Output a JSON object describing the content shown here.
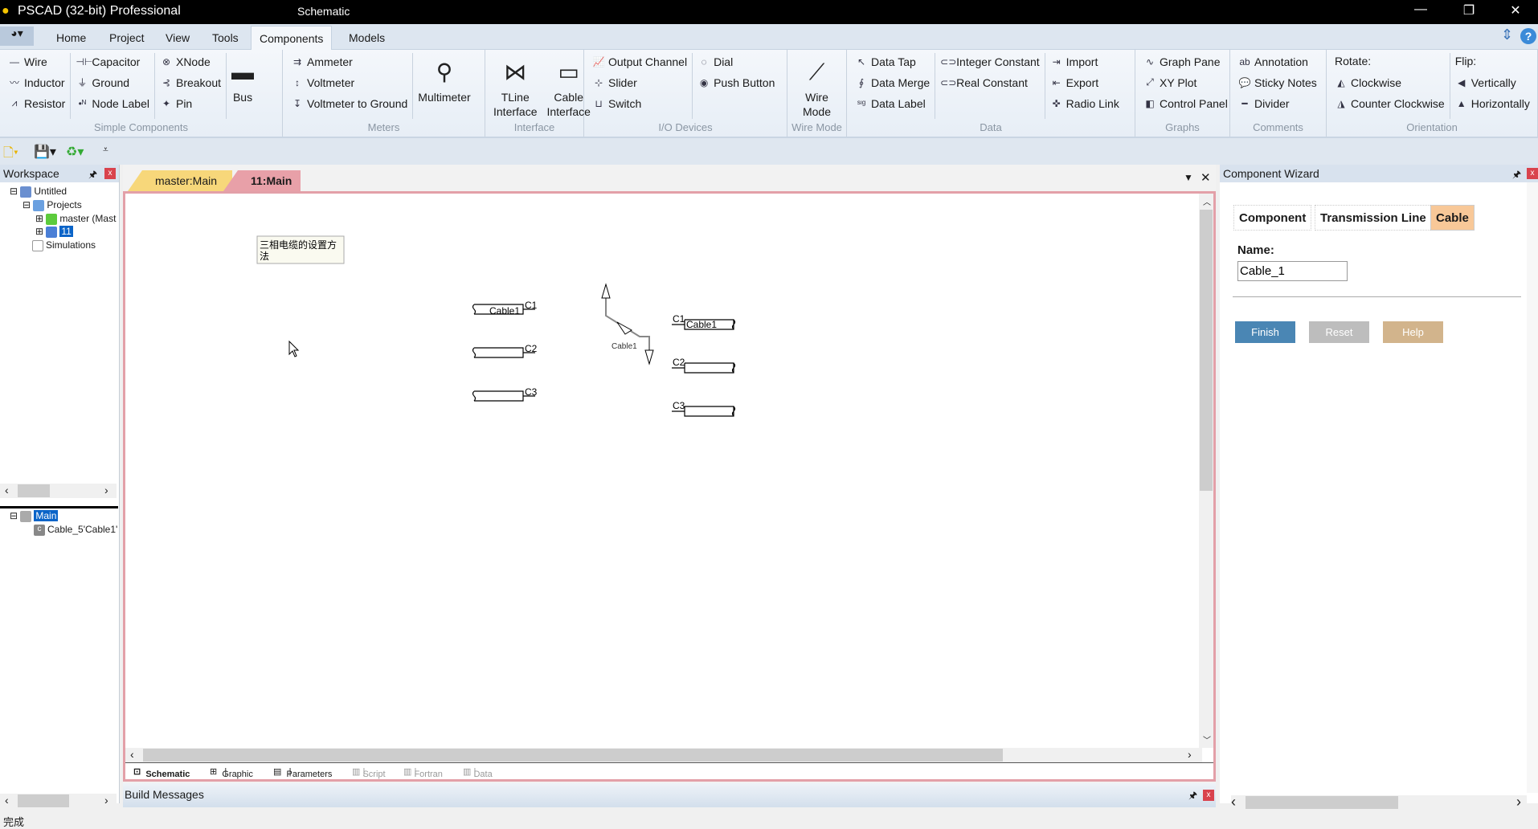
{
  "title": {
    "app": "PSCAD (32-bit) Professional",
    "context": "Schematic"
  },
  "ribbon_tabs": [
    "Home",
    "Project",
    "View",
    "Tools",
    "Components",
    "Models"
  ],
  "active_tab": "Components",
  "ribbon": [
    {
      "label": "Simple Components",
      "width": 352,
      "cols": [
        {
          "sep": true,
          "items": [
            {
              "icon": "—",
              "name": "wire",
              "text": "Wire"
            },
            {
              "icon": "〰",
              "name": "inductor",
              "text": "Inductor"
            },
            {
              "icon": "⩘",
              "name": "resistor",
              "text": "Resistor"
            }
          ]
        },
        {
          "sep": true,
          "items": [
            {
              "icon": "⊣⊢",
              "name": "capacitor",
              "text": "Capacitor"
            },
            {
              "icon": "⏚",
              "name": "ground",
              "text": "Ground"
            },
            {
              "icon": "•ᴺ",
              "name": "node-label",
              "text": "Node Label"
            }
          ]
        },
        {
          "sep": true,
          "items": [
            {
              "icon": "⊗",
              "name": "xnode",
              "text": "XNode"
            },
            {
              "icon": "⊰",
              "name": "breakout",
              "text": "Breakout"
            },
            {
              "icon": "✦",
              "name": "pin",
              "text": "Pin"
            }
          ]
        },
        {
          "big": {
            "icon": "▬",
            "name": "bus",
            "text": "Bus"
          }
        }
      ]
    },
    {
      "label": "Meters",
      "width": 252,
      "cols": [
        {
          "sep": true,
          "items": [
            {
              "icon": "⇉",
              "name": "ammeter",
              "text": "Ammeter"
            },
            {
              "icon": "↕",
              "name": "voltmeter",
              "text": "Voltmeter"
            },
            {
              "icon": "↧",
              "name": "voltmeter-to-ground",
              "text": "Voltmeter to Ground"
            }
          ]
        },
        {
          "big": {
            "icon": "⚲",
            "name": "multimeter",
            "text": "Multimeter"
          }
        }
      ]
    },
    {
      "label": "Interface",
      "width": 123,
      "cols": [
        {
          "big": {
            "icon": "⋈",
            "name": "tline-interface",
            "text": "TLine Interface"
          }
        },
        {
          "big": {
            "icon": "▭",
            "name": "cable-interface",
            "text": "Cable Interface"
          }
        }
      ]
    },
    {
      "label": "I/O Devices",
      "width": 253,
      "cols": [
        {
          "sep": true,
          "items": [
            {
              "icon": "📈",
              "name": "output-channel",
              "text": "Output Channel"
            },
            {
              "icon": "⊹",
              "name": "slider",
              "text": "Slider"
            },
            {
              "icon": "⊔",
              "name": "switch",
              "text": "Switch"
            }
          ]
        },
        {
          "items": [
            {
              "icon": "◌",
              "name": "dial",
              "text": "Dial"
            },
            {
              "icon": "◉",
              "name": "push-button",
              "text": "Push Button"
            }
          ]
        }
      ]
    },
    {
      "label": "Wire Mode",
      "width": 74,
      "cols": [
        {
          "big": {
            "icon": "⟋",
            "name": "wire-mode",
            "text": "Wire Mode"
          }
        }
      ]
    },
    {
      "label": "Data",
      "width": 359,
      "cols": [
        {
          "sep": true,
          "items": [
            {
              "icon": "↖",
              "name": "data-tap",
              "text": "Data Tap"
            },
            {
              "icon": "∮",
              "name": "data-merge",
              "text": "Data Merge"
            },
            {
              "icon": "ˢᶦᵍ",
              "name": "data-label",
              "text": "Data Label"
            }
          ]
        },
        {
          "sep": true,
          "items": [
            {
              "icon": "⊂⊃",
              "name": "integer-constant",
              "text": "Integer Constant"
            },
            {
              "icon": "⊂⊃",
              "name": "real-constant",
              "text": "Real Constant"
            }
          ]
        },
        {
          "items": [
            {
              "icon": "⇥",
              "name": "import",
              "text": "Import"
            },
            {
              "icon": "⇤",
              "name": "export",
              "text": "Export"
            },
            {
              "icon": "✜",
              "name": "radio-link",
              "text": "Radio Link"
            }
          ]
        }
      ]
    },
    {
      "label": "Graphs",
      "width": 118,
      "cols": [
        {
          "items": [
            {
              "icon": "∿",
              "name": "graph-pane",
              "text": "Graph Pane"
            },
            {
              "icon": "⤢",
              "name": "xy-plot",
              "text": "XY Plot"
            },
            {
              "icon": "◧",
              "name": "control-panel",
              "text": "Control Panel"
            }
          ]
        }
      ]
    },
    {
      "label": "Comments",
      "width": 120,
      "cols": [
        {
          "items": [
            {
              "icon": "ab",
              "name": "annotation",
              "text": "Annotation"
            },
            {
              "icon": "💬",
              "name": "sticky-notes",
              "text": "Sticky Notes"
            },
            {
              "icon": "━",
              "name": "divider",
              "text": "Divider"
            }
          ]
        }
      ]
    },
    {
      "label": "Orientation",
      "width": 263,
      "cols": [
        {
          "sep": true,
          "heading": "Rotate:",
          "items": [
            {
              "icon": "◭",
              "name": "rotate-clockwise",
              "text": "Clockwise"
            },
            {
              "icon": "◮",
              "name": "rotate-counter-clockwise",
              "text": "Counter Clockwise"
            }
          ]
        },
        {
          "heading": "Flip:",
          "items": [
            {
              "icon": "◀",
              "name": "flip-vertically",
              "text": "Vertically"
            },
            {
              "icon": "▲",
              "name": "flip-horizontally",
              "text": "Horizontally"
            }
          ]
        }
      ]
    }
  ],
  "workspace": {
    "title": "Workspace",
    "tree": [
      "Untitled",
      "Projects",
      "master (Mast",
      "11",
      "Simulations"
    ],
    "tree2": [
      "Main",
      "Cable_5'Cable1'"
    ]
  },
  "doc_tabs": [
    "master:Main",
    "11:Main"
  ],
  "canvas": {
    "annotation_line1": "三相电缆的设置方",
    "annotation_line2": "法",
    "cable_label": "Cable1",
    "c1": "C1",
    "c2": "C2",
    "c3": "C3"
  },
  "view_tabs": [
    "Schematic",
    "Graphic",
    "Parameters",
    "Script",
    "Fortran",
    "Data"
  ],
  "wizard": {
    "title": "Component Wizard",
    "tabs": [
      "Component",
      "Transmission Line",
      "Cable"
    ],
    "name_label": "Name:",
    "name_value": "Cable_1",
    "finish": "Finish",
    "reset": "Reset",
    "help": "Help",
    "colors": {
      "finish": "#4a86b4",
      "reset": "#bdbdbd",
      "help": "#d2b48c",
      "active_tab": "#f8c898"
    }
  },
  "build_messages": "Build Messages",
  "status": "完成"
}
